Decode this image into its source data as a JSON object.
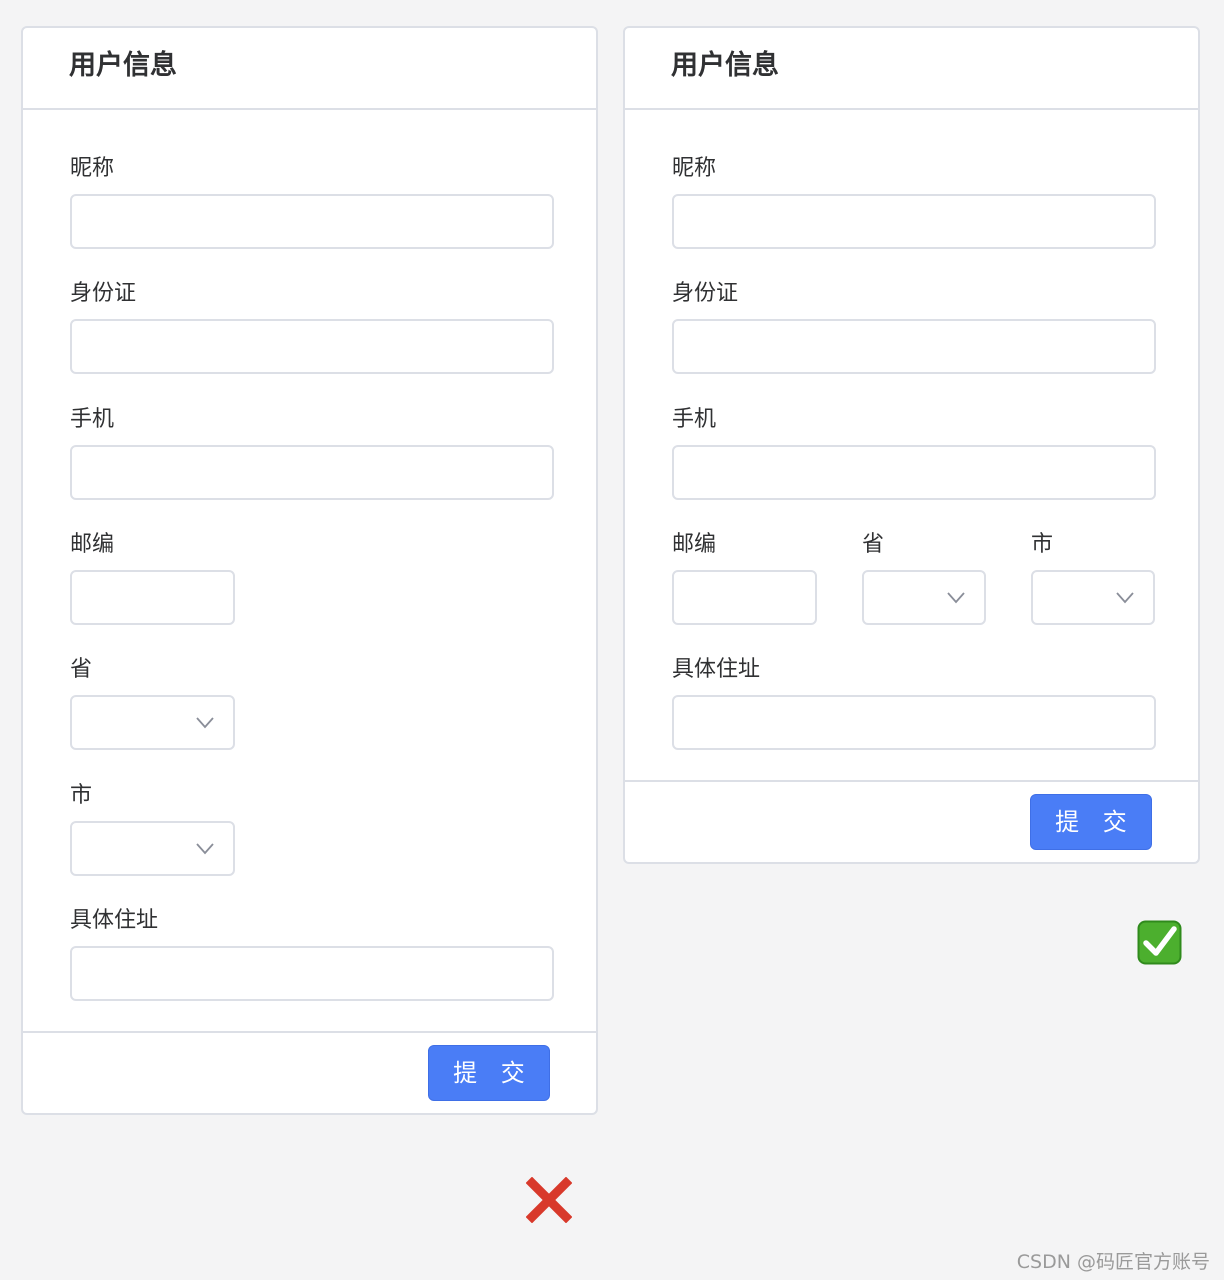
{
  "form_left": {
    "title": "用户信息",
    "fields": {
      "nickname": {
        "label": "昵称",
        "value": ""
      },
      "id_card": {
        "label": "身份证",
        "value": ""
      },
      "phone": {
        "label": "手机",
        "value": ""
      },
      "postcode": {
        "label": "邮编",
        "value": ""
      },
      "province": {
        "label": "省",
        "selected": ""
      },
      "city": {
        "label": "市",
        "selected": ""
      },
      "address": {
        "label": "具体住址",
        "value": ""
      }
    },
    "submit_label": "提 交"
  },
  "form_right": {
    "title": "用户信息",
    "fields": {
      "nickname": {
        "label": "昵称",
        "value": ""
      },
      "id_card": {
        "label": "身份证",
        "value": ""
      },
      "phone": {
        "label": "手机",
        "value": ""
      },
      "postcode": {
        "label": "邮编",
        "value": ""
      },
      "province": {
        "label": "省",
        "selected": ""
      },
      "city": {
        "label": "市",
        "selected": ""
      },
      "address": {
        "label": "具体住址",
        "value": ""
      }
    },
    "submit_label": "提 交"
  },
  "verdicts": {
    "left": "wrong-mark-icon",
    "right": "correct-mark-icon"
  },
  "colors": {
    "primary": "#4a7df6",
    "border": "#dcdfe6",
    "wrong": "#d8392b",
    "correct": "#4caf2e"
  },
  "watermark": "CSDN @码匠官方账号"
}
